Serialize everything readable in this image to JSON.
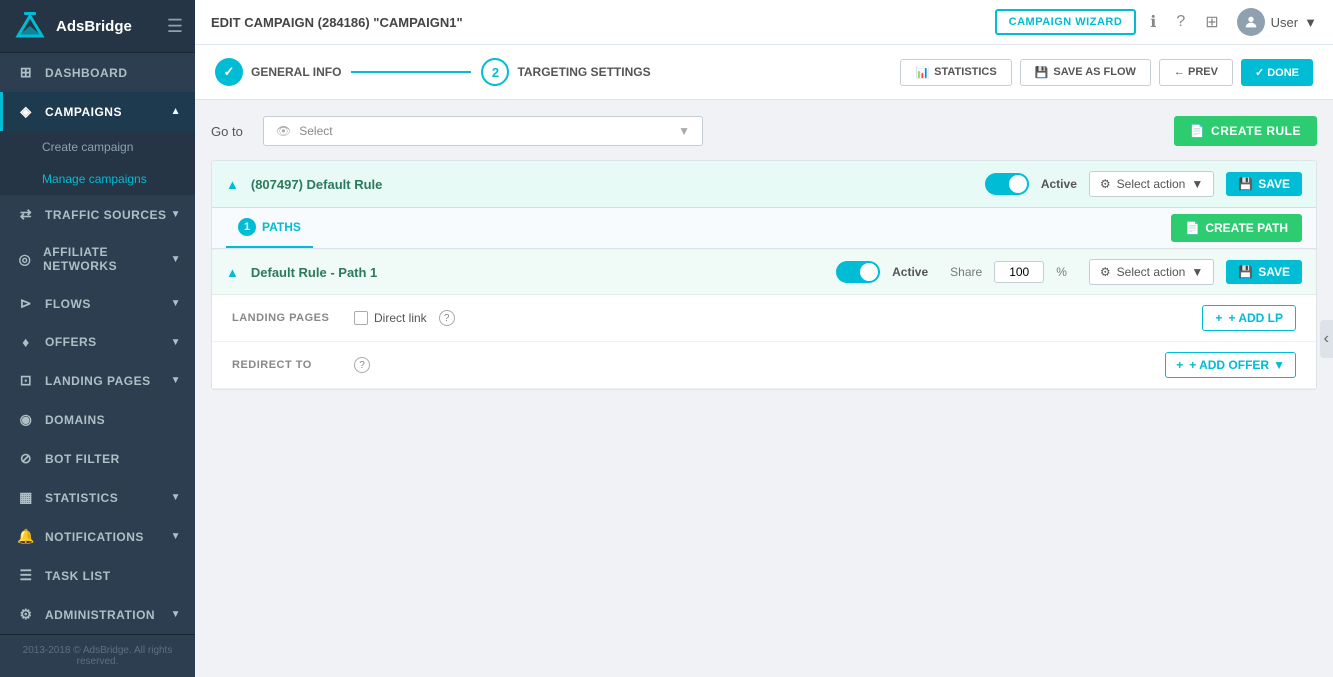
{
  "sidebar": {
    "logo_text": "AdsBridge",
    "items": [
      {
        "id": "dashboard",
        "label": "DASHBOARD",
        "icon": "⊞",
        "has_arrow": false
      },
      {
        "id": "campaigns",
        "label": "CAMPAIGNS",
        "icon": "◈",
        "has_arrow": true,
        "active": true,
        "sub_items": [
          {
            "id": "create-campaign",
            "label": "Create campaign"
          },
          {
            "id": "manage-campaigns",
            "label": "Manage campaigns",
            "active": true
          }
        ]
      },
      {
        "id": "traffic-sources",
        "label": "TRAFFIC SOURCES",
        "icon": "⇄",
        "has_arrow": true
      },
      {
        "id": "affiliate-networks",
        "label": "AFFILIATE NETWORKS",
        "icon": "◎",
        "has_arrow": true
      },
      {
        "id": "flows",
        "label": "FLOWS",
        "icon": "⊳",
        "has_arrow": true
      },
      {
        "id": "offers",
        "label": "OFFERS",
        "icon": "♦",
        "has_arrow": true
      },
      {
        "id": "landing-pages",
        "label": "LANDING PAGES",
        "icon": "⊡",
        "has_arrow": true
      },
      {
        "id": "domains",
        "label": "DOMAINS",
        "icon": "◉",
        "has_arrow": false
      },
      {
        "id": "bot-filter",
        "label": "BOT FILTER",
        "icon": "⊘",
        "has_arrow": false
      },
      {
        "id": "statistics",
        "label": "STATISTICS",
        "icon": "▦",
        "has_arrow": true
      },
      {
        "id": "notifications",
        "label": "NOTIFICATIONS",
        "icon": "🔔",
        "has_arrow": true
      },
      {
        "id": "task-list",
        "label": "TASK LIST",
        "icon": "☰",
        "has_arrow": false
      },
      {
        "id": "administration",
        "label": "ADMINISTRATION",
        "icon": "⚙",
        "has_arrow": true
      }
    ],
    "footer": "2013-2018 © AdsBridge.\nAll rights reserved."
  },
  "topbar": {
    "title": "EDIT CAMPAIGN (284186) \"CAMPAIGN1\"",
    "campaign_wizard_btn": "CAMPAIGN WIZARD",
    "user_label": "User",
    "info_icon": "ℹ",
    "help_icon": "?",
    "grid_icon": "⊞",
    "avatar_icon": "👤"
  },
  "wizard": {
    "step1_label": "GENERAL INFO",
    "step2_label": "TARGETING SETTINGS",
    "step2_num": "2",
    "statistics_btn": "STATISTICS",
    "save_flow_btn": "SAVE AS FLOW",
    "prev_btn": "← PREV",
    "done_btn": "✓ DONE"
  },
  "content": {
    "goto_label": "Go to",
    "goto_placeholder": "Select",
    "create_rule_btn": "CREATE RULE",
    "rule": {
      "id": "(807497)",
      "name": "Default Rule",
      "title": "(807497) Default Rule",
      "active": true,
      "active_label": "Active",
      "select_action_label": "Select action",
      "save_label": "SAVE",
      "paths_count": 1,
      "paths_label": "PATHS",
      "create_path_btn": "CREATE PATH",
      "path": {
        "title": "Default Rule - Path 1",
        "active": true,
        "active_label": "Active",
        "share_label": "Share",
        "share_value": "100",
        "percent": "%",
        "select_action_label": "Select action",
        "save_label": "SAVE",
        "landing_pages_label": "LANDING PAGES",
        "direct_link_label": "Direct link",
        "add_lp_btn": "+ ADD LP",
        "redirect_to_label": "REDIRECT TO",
        "add_offer_btn": "+ ADD OFFER",
        "help_tooltip": "?"
      }
    }
  },
  "colors": {
    "teal": "#00bcd4",
    "green": "#2ecc71",
    "sidebar_bg": "#2c3e50",
    "active_green": "#00c887"
  }
}
